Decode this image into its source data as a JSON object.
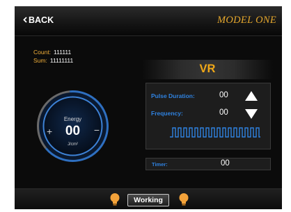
{
  "header": {
    "back_label": "BACK",
    "back_icon": "chevron-left-icon",
    "model": "MODEL ONE"
  },
  "stats": {
    "count_label": "Count:",
    "count_value": "111111",
    "sum_label": "Sum:",
    "sum_value": "11111111"
  },
  "energy": {
    "label": "Energy",
    "value": "00",
    "unit": "J/cm²",
    "increase_symbol": "+",
    "decrease_symbol": "−"
  },
  "mode": {
    "title": "VR"
  },
  "settings": {
    "pulse_duration_label": "Pulse Duration:",
    "pulse_duration_value": "00",
    "frequency_label": "Frequency:",
    "frequency_value": "00",
    "up_icon": "triangle-up-icon",
    "down_icon": "triangle-down-icon"
  },
  "timer": {
    "label": "Timer:",
    "value": "00"
  },
  "footer": {
    "status_button": "Working",
    "indicator_icon": "lightbulb-icon"
  },
  "colors": {
    "accent_orange": "#f0a818",
    "accent_blue": "#2f82e0",
    "model_gold": "#e6a82d",
    "background": "#0b0b0b"
  }
}
